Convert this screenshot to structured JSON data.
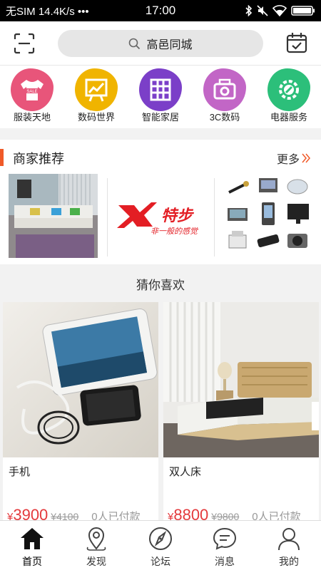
{
  "status_bar": {
    "carrier": "无SIM",
    "speed": "14.4K/s",
    "dots": "•••",
    "time": "17:00"
  },
  "header": {
    "search_text": "高邑同城"
  },
  "categories": [
    {
      "label": "服装天地",
      "icon": "tshirt-icon",
      "color": "#e8557a",
      "badge": "SALE"
    },
    {
      "label": "数码世界",
      "icon": "chart-board-icon",
      "color": "#f0b400"
    },
    {
      "label": "智能家居",
      "icon": "building-icon",
      "color": "#7b3fc8"
    },
    {
      "label": "3C数码",
      "icon": "camera-icon",
      "color": "#c266c6"
    },
    {
      "label": "电器服务",
      "icon": "wrench-gear-icon",
      "color": "#2cbf7a"
    }
  ],
  "merchant": {
    "title": "商家推荐",
    "more": "更多",
    "xtep_brand": "特步",
    "xtep_slogan": "非一般的感觉"
  },
  "guess": {
    "title": "猜你喜欢",
    "products": [
      {
        "name": "手机",
        "currency": "¥",
        "price": "3900",
        "old_price": "¥4100",
        "paid": "0人已付款"
      },
      {
        "name": "双人床",
        "currency": "¥",
        "price": "8800",
        "old_price": "¥9800",
        "paid": "0人已付款"
      }
    ]
  },
  "tabs": [
    {
      "label": "首页",
      "icon": "home-icon",
      "active": true
    },
    {
      "label": "发现",
      "icon": "location-pin-icon",
      "active": false
    },
    {
      "label": "论坛",
      "icon": "compass-icon",
      "active": false
    },
    {
      "label": "消息",
      "icon": "chat-bubble-icon",
      "active": false
    },
    {
      "label": "我的",
      "icon": "user-icon",
      "active": false
    }
  ],
  "colors": {
    "accent": "#f05a28",
    "price": "#e4393c"
  }
}
